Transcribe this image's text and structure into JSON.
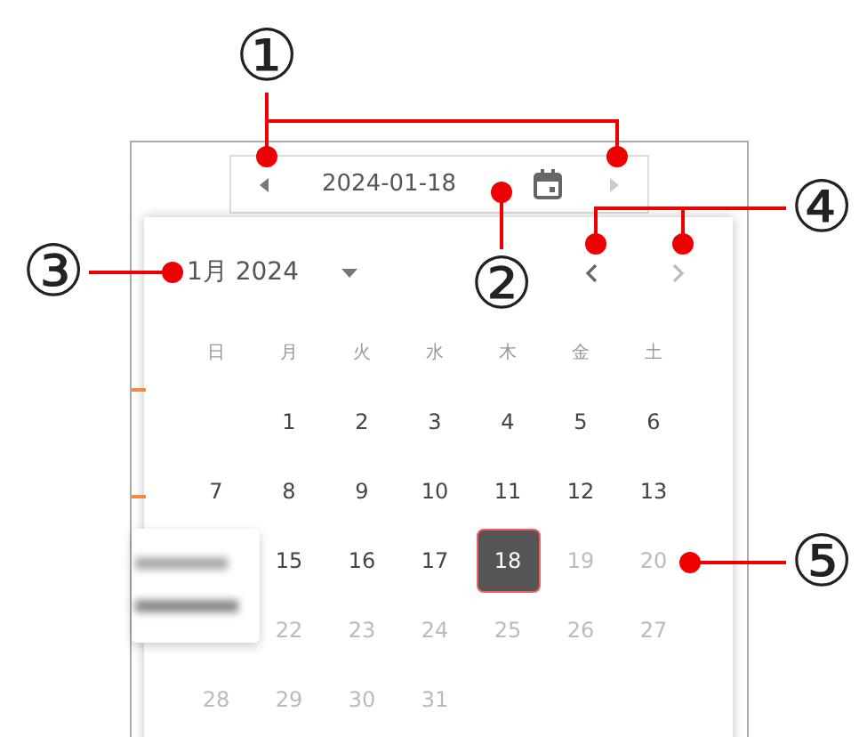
{
  "date_bar": {
    "value": "2024-01-18"
  },
  "calendar": {
    "month_label": "1月 2024",
    "weekdays": [
      "日",
      "月",
      "火",
      "水",
      "木",
      "金",
      "土"
    ],
    "weeks": [
      {
        "days": [
          {
            "kind": "blank"
          },
          {
            "kind": "day",
            "label": "1",
            "selected": false,
            "disabled": false
          },
          {
            "kind": "day",
            "label": "2",
            "selected": false,
            "disabled": false
          },
          {
            "kind": "day",
            "label": "3",
            "selected": false,
            "disabled": false
          },
          {
            "kind": "day",
            "label": "4",
            "selected": false,
            "disabled": false
          },
          {
            "kind": "day",
            "label": "5",
            "selected": false,
            "disabled": false
          },
          {
            "kind": "day",
            "label": "6",
            "selected": false,
            "disabled": false
          }
        ]
      },
      {
        "days": [
          {
            "kind": "day",
            "label": "7",
            "selected": false,
            "disabled": false
          },
          {
            "kind": "day",
            "label": "8",
            "selected": false,
            "disabled": false
          },
          {
            "kind": "day",
            "label": "9",
            "selected": false,
            "disabled": false
          },
          {
            "kind": "day",
            "label": "10",
            "selected": false,
            "disabled": false
          },
          {
            "kind": "day",
            "label": "11",
            "selected": false,
            "disabled": false
          },
          {
            "kind": "day",
            "label": "12",
            "selected": false,
            "disabled": false
          },
          {
            "kind": "day",
            "label": "13",
            "selected": false,
            "disabled": false
          }
        ]
      },
      {
        "days": [
          {
            "kind": "blank"
          },
          {
            "kind": "day",
            "label": "15",
            "selected": false,
            "disabled": false
          },
          {
            "kind": "day",
            "label": "16",
            "selected": false,
            "disabled": false
          },
          {
            "kind": "day",
            "label": "17",
            "selected": false,
            "disabled": false
          },
          {
            "kind": "day",
            "label": "18",
            "selected": true,
            "disabled": false
          },
          {
            "kind": "day",
            "label": "19",
            "selected": false,
            "disabled": true
          },
          {
            "kind": "day",
            "label": "20",
            "selected": false,
            "disabled": true
          }
        ]
      },
      {
        "days": [
          {
            "kind": "blank"
          },
          {
            "kind": "day",
            "label": "22",
            "selected": false,
            "disabled": true
          },
          {
            "kind": "day",
            "label": "23",
            "selected": false,
            "disabled": true
          },
          {
            "kind": "day",
            "label": "24",
            "selected": false,
            "disabled": true
          },
          {
            "kind": "day",
            "label": "25",
            "selected": false,
            "disabled": true
          },
          {
            "kind": "day",
            "label": "26",
            "selected": false,
            "disabled": true
          },
          {
            "kind": "day",
            "label": "27",
            "selected": false,
            "disabled": true
          }
        ]
      },
      {
        "days": [
          {
            "kind": "day",
            "label": "28",
            "selected": false,
            "disabled": true
          },
          {
            "kind": "day",
            "label": "29",
            "selected": false,
            "disabled": true
          },
          {
            "kind": "day",
            "label": "30",
            "selected": false,
            "disabled": true
          },
          {
            "kind": "day",
            "label": "31",
            "selected": false,
            "disabled": true
          },
          {
            "kind": "blank"
          },
          {
            "kind": "blank"
          },
          {
            "kind": "blank"
          }
        ]
      }
    ]
  },
  "callouts": [
    {
      "label": "①"
    },
    {
      "label": "②"
    },
    {
      "label": "③"
    },
    {
      "label": "④"
    },
    {
      "label": "⑤"
    }
  ]
}
